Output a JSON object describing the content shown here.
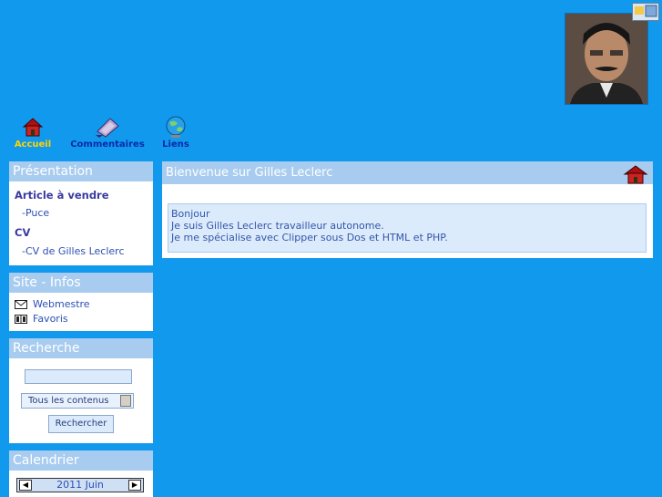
{
  "nav": {
    "accueil": "Accueil",
    "commentaires": "Commentaires",
    "liens": "Liens"
  },
  "sidebar": {
    "presentation": {
      "title": "Présentation",
      "items": [
        {
          "type": "category",
          "label": "Article à vendre"
        },
        {
          "type": "sub",
          "label": "-Puce"
        },
        {
          "type": "category",
          "label": "CV"
        },
        {
          "type": "sub",
          "label": "-CV de Gilles Leclerc"
        }
      ]
    },
    "site_infos": {
      "title": "Site - Infos",
      "webmestre": "Webmestre",
      "favoris": "Favoris"
    },
    "recherche": {
      "title": "Recherche",
      "input_value": "",
      "select_value": "Tous les contenus",
      "button_label": "Rechercher"
    },
    "calendrier": {
      "title": "Calendrier",
      "month_label": "2011 Juin"
    }
  },
  "main": {
    "title": "Bienvenue sur Gilles Leclerc",
    "lines": [
      "Bonjour",
      "Je suis Gilles Leclerc travailleur autonome.",
      "Je me spécialise avec  Clipper sous Dos et HTML et PHP."
    ]
  }
}
